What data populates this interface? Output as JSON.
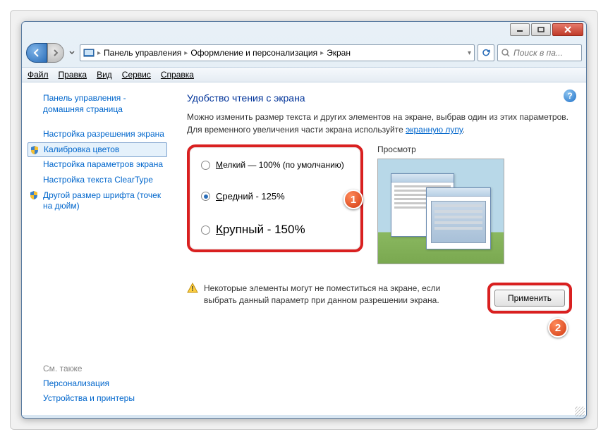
{
  "titlebar": {
    "minimize": "—",
    "maximize": "□",
    "close": "×"
  },
  "breadcrumb": {
    "root": "Панель управления",
    "mid": "Оформление и персонализация",
    "leaf": "Экран"
  },
  "search": {
    "placeholder": "Поиск в па..."
  },
  "menu": {
    "file": "Файл",
    "edit": "Правка",
    "view": "Вид",
    "tools": "Сервис",
    "help": "Справка"
  },
  "sidebar": {
    "home": "Панель управления - домашняя страница",
    "items": [
      "Настройка разрешения экрана",
      "Калибровка цветов",
      "Настройка параметров экрана",
      "Настройка текста ClearType",
      "Другой размер шрифта (точек на дюйм)"
    ],
    "see_also_heading": "См. также",
    "see_also": [
      "Персонализация",
      "Устройства и принтеры"
    ]
  },
  "main": {
    "heading": "Удобство чтения с экрана",
    "desc_pre": "Можно изменить размер текста и других элементов на экране, выбрав один из этих параметров. Для временного увеличения части экрана используйте ",
    "desc_link": "экранную лупу",
    "desc_post": ".",
    "options": {
      "small_pre": "М",
      "small_rest": "елкий — 100% (по умолчанию)",
      "med_pre": "С",
      "med_rest": "редний - 125%",
      "large_pre": "К",
      "large_rest": "рупный - 150%",
      "selected": "medium"
    },
    "preview_label": "Просмотр",
    "warning": "Некоторые элементы могут не поместиться на экране, если выбрать данный параметр при данном разрешении экрана.",
    "apply": "Применить"
  },
  "badges": {
    "one": "1",
    "two": "2"
  },
  "colors": {
    "highlight": "#d92020",
    "link": "#0066cc",
    "heading": "#003399"
  }
}
